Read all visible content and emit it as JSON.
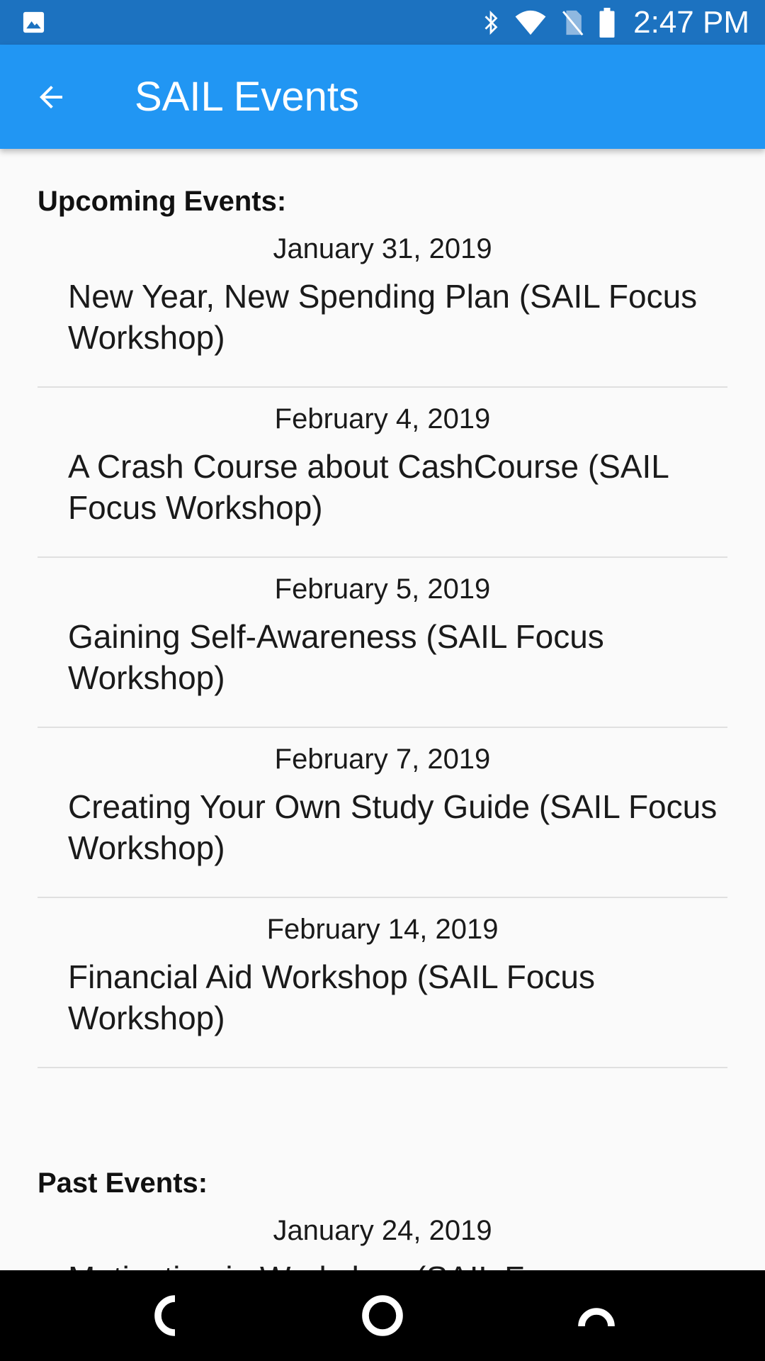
{
  "status_bar": {
    "time": "2:47 PM",
    "icons": [
      "image-icon",
      "bluetooth-icon",
      "wifi-icon",
      "no-sim-icon",
      "battery-icon"
    ]
  },
  "app_bar": {
    "title": "SAIL Events",
    "back_icon": "arrow-back-icon"
  },
  "sections": {
    "upcoming_label": "Upcoming Events:",
    "upcoming": [
      {
        "date": "January 31, 2019",
        "title": "New Year, New Spending Plan (SAIL Focus Workshop)"
      },
      {
        "date": "February 4, 2019",
        "title": "A Crash Course about CashCourse (SAIL Focus Workshop)"
      },
      {
        "date": "February 5, 2019",
        "title": "Gaining Self-Awareness (SAIL Focus Workshop)"
      },
      {
        "date": "February 7, 2019",
        "title": "Creating Your Own Study Guide (SAIL Focus Workshop)"
      },
      {
        "date": "February 14, 2019",
        "title": "Financial Aid Workshop (SAIL Focus Workshop)"
      }
    ],
    "past_label": "Past Events:",
    "past": [
      {
        "date": "January 24, 2019",
        "title": "Motivation in Workshop (SAIL Focus Workshop)"
      }
    ]
  },
  "nav_bar": {
    "buttons": [
      "back-nav-icon",
      "home-nav-icon",
      "recents-nav-icon"
    ]
  },
  "colors": {
    "status_bar": "#1c72c0",
    "app_bar": "#2196f3",
    "background": "#fafafa",
    "divider": "#e0e0e0"
  }
}
